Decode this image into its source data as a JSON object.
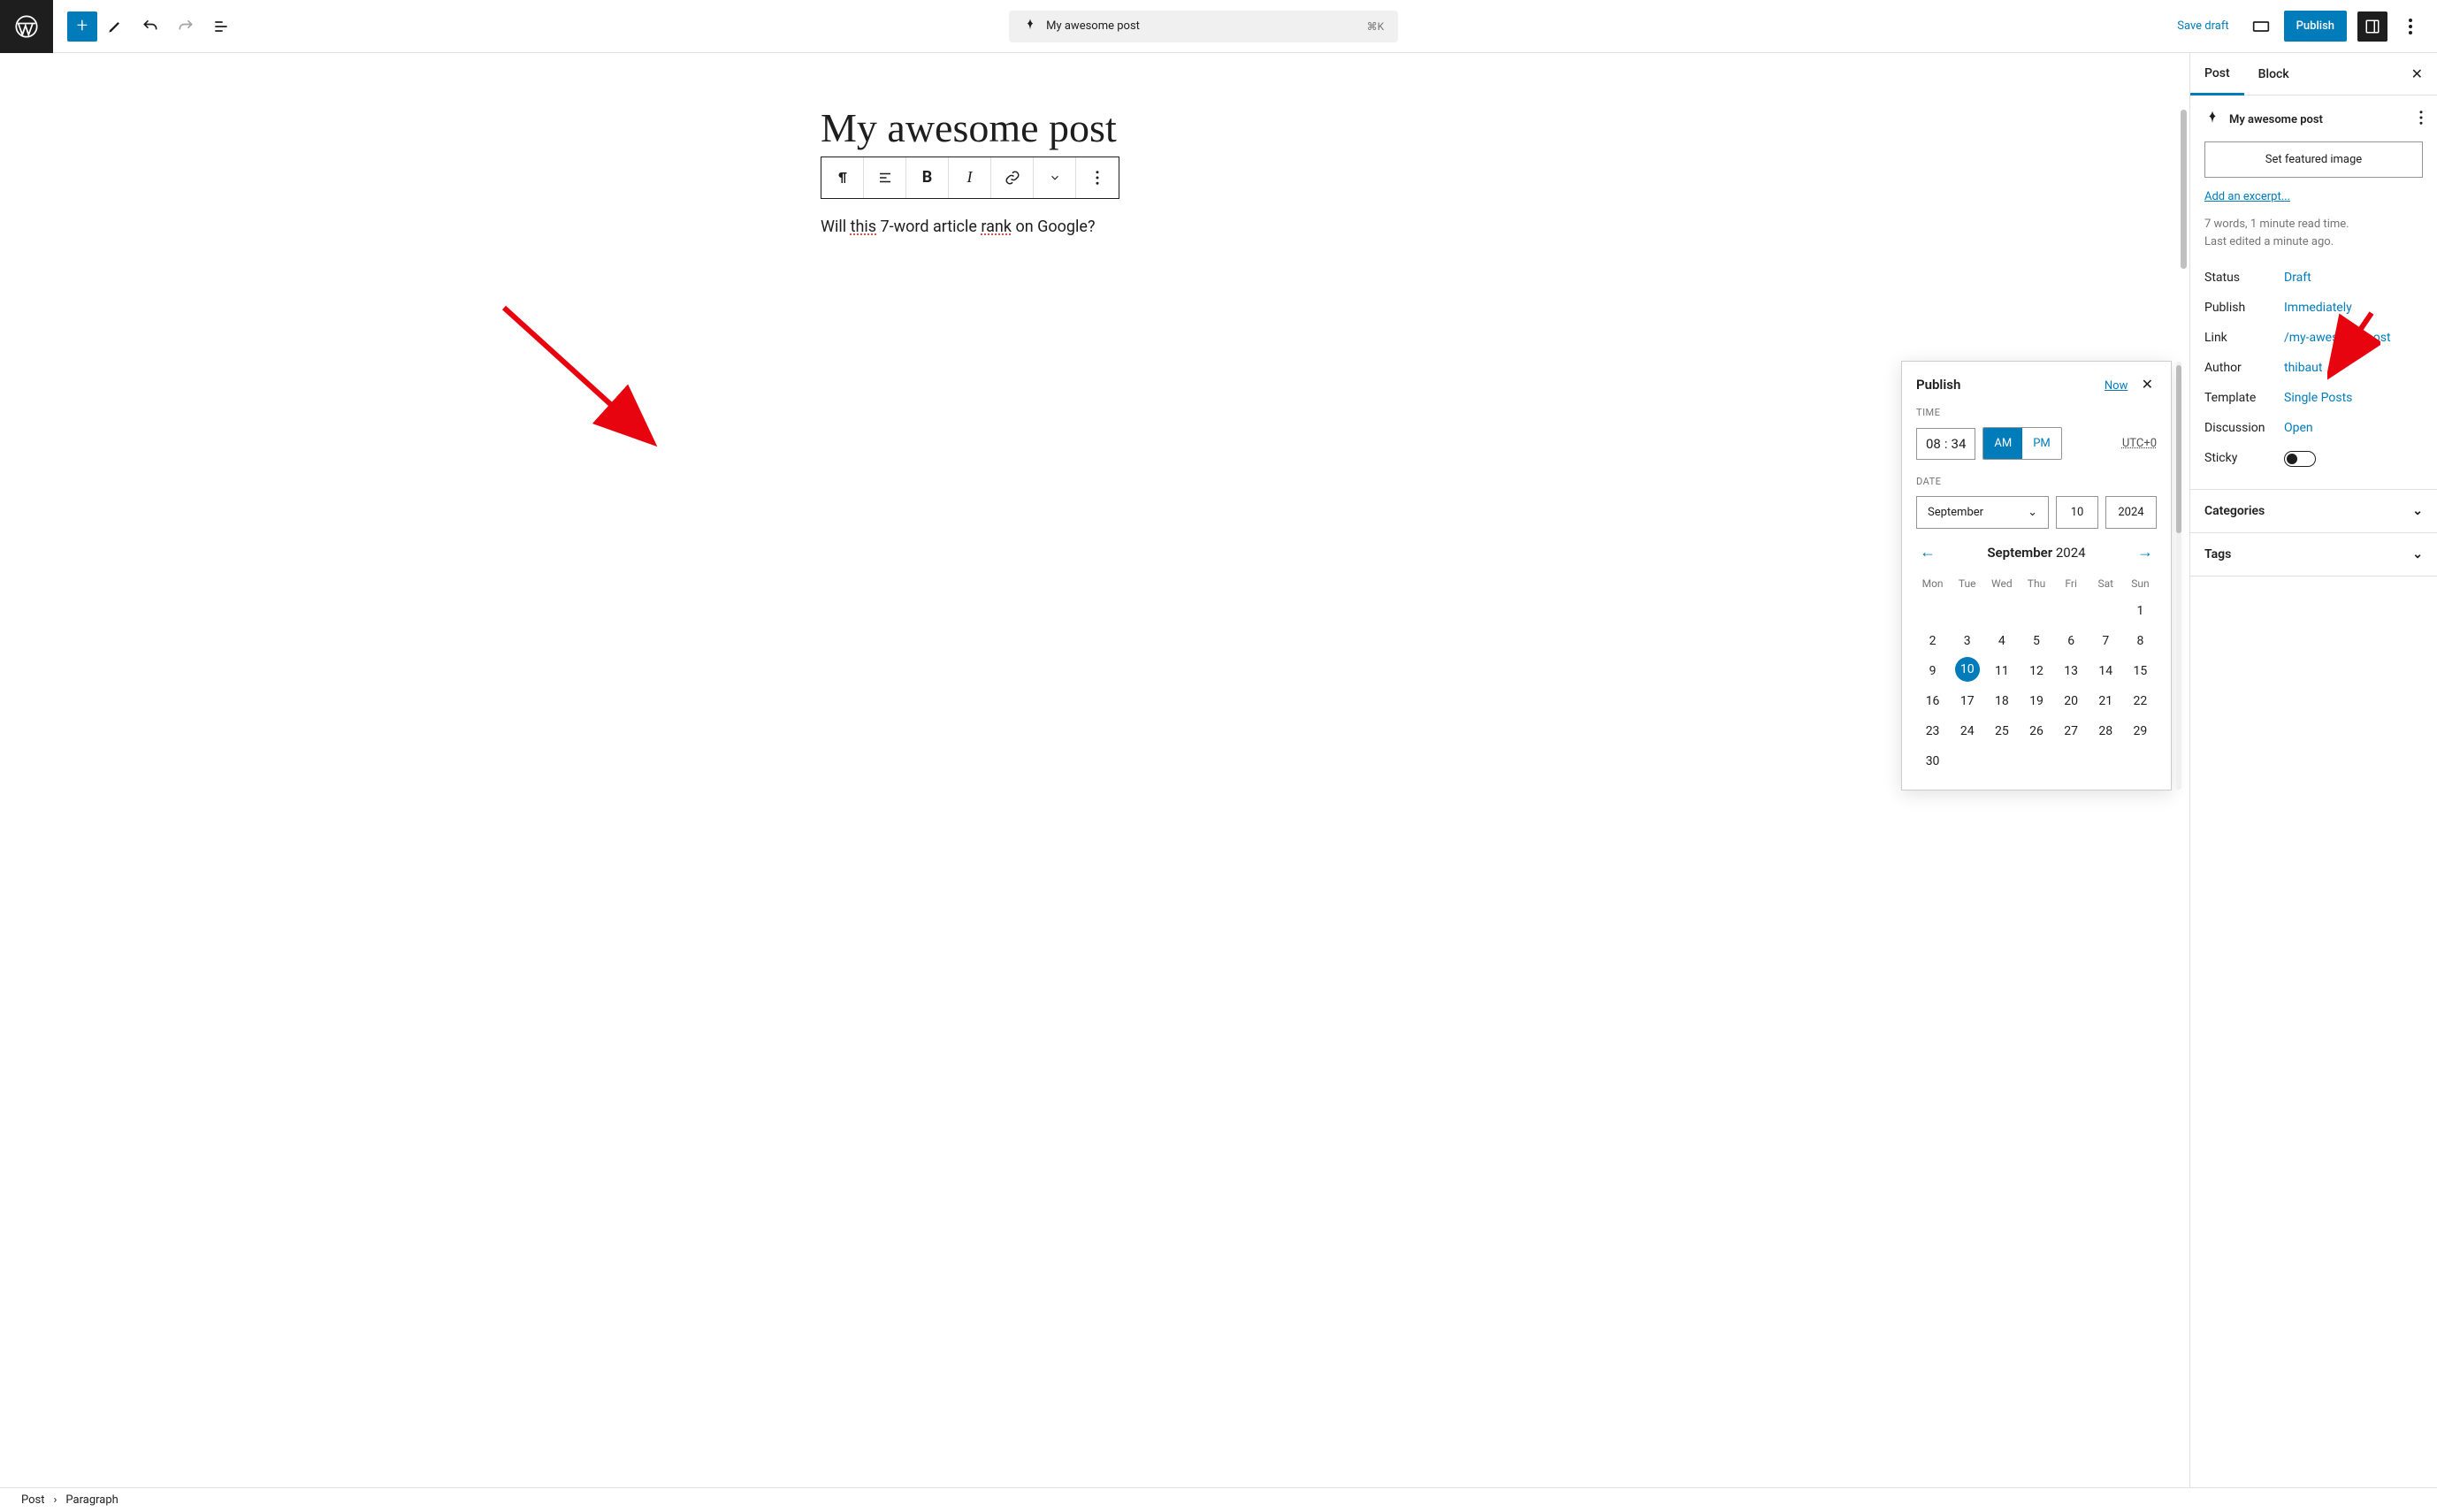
{
  "topbar": {
    "doc_title": "My awesome post",
    "shortcut": "⌘K",
    "save_draft": "Save draft",
    "publish": "Publish"
  },
  "editor": {
    "post_title": "My awesome post",
    "body_prefix": "Will ",
    "body_word1": "this",
    "body_mid": " 7-word article ",
    "body_word2": "rank",
    "body_suffix": " on Google?",
    "toolbar": {
      "bold": "B",
      "italic": "I"
    }
  },
  "popover": {
    "title": "Publish",
    "now": "Now",
    "time_label": "TIME",
    "hour": "08",
    "sep": ":",
    "minute": "34",
    "am": "AM",
    "pm": "PM",
    "tz": "UTC+0",
    "date_label": "DATE",
    "month": "September",
    "day": "10",
    "year": "2024",
    "cal_month": "September",
    "cal_year": "2024",
    "dow": [
      "Mon",
      "Tue",
      "Wed",
      "Thu",
      "Fri",
      "Sat",
      "Sun"
    ],
    "weeks": [
      [
        "",
        "",
        "",
        "",
        "",
        "",
        "1"
      ],
      [
        "2",
        "3",
        "4",
        "5",
        "6",
        "7",
        "8"
      ],
      [
        "9",
        "10",
        "11",
        "12",
        "13",
        "14",
        "15"
      ],
      [
        "16",
        "17",
        "18",
        "19",
        "20",
        "21",
        "22"
      ],
      [
        "23",
        "24",
        "25",
        "26",
        "27",
        "28",
        "29"
      ],
      [
        "30",
        "",
        "",
        "",
        "",
        "",
        ""
      ]
    ],
    "selected_day": "10"
  },
  "sidebar": {
    "tabs": {
      "post": "Post",
      "block": "Block"
    },
    "doc_title": "My awesome post",
    "featured": "Set featured image",
    "excerpt": "Add an excerpt...",
    "meta1": "7 words, 1 minute read time.",
    "meta2": "Last edited a minute ago.",
    "rows": {
      "status_k": "Status",
      "status_v": "Draft",
      "publish_k": "Publish",
      "publish_v": "Immediately",
      "link_k": "Link",
      "link_v": "/my-awesome-post",
      "author_k": "Author",
      "author_v": "thibaut",
      "template_k": "Template",
      "template_v": "Single Posts",
      "discussion_k": "Discussion",
      "discussion_v": "Open",
      "sticky_k": "Sticky"
    },
    "categories": "Categories",
    "tags": "Tags"
  },
  "breadcrumb": {
    "a": "Post",
    "sep": "›",
    "b": "Paragraph"
  }
}
